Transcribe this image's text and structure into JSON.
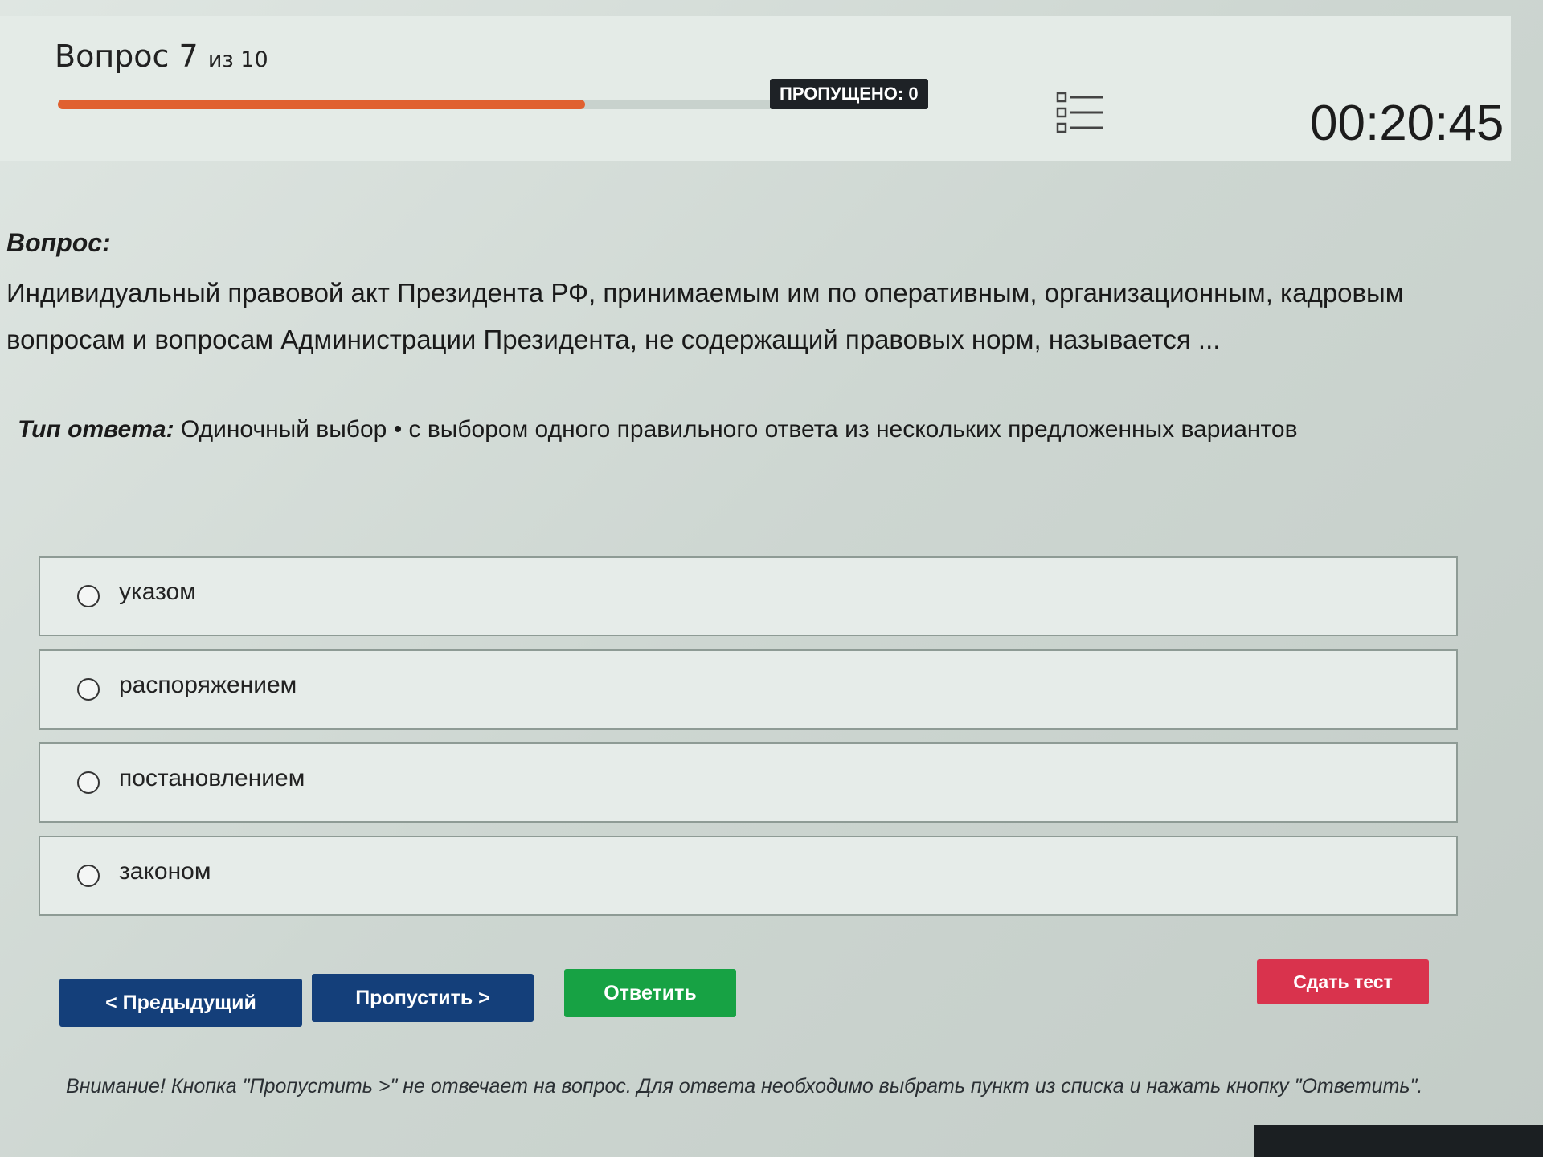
{
  "header": {
    "question_word": "Вопрос",
    "question_number": "7",
    "question_of": "из 10",
    "progress_percent": 61,
    "skipped_label": "ПРОПУЩЕНО: 0",
    "list_icon": "question-list-icon",
    "timer": "00:20:45",
    "progress_color": "#e0602f"
  },
  "question": {
    "label": "Вопрос:",
    "text": "Индивидуальный правовой акт Президента РФ, принимаемым им по оперативным, организационным, кадровым вопросам и вопросам Администрации Президента, не содержащий правовых норм, называется ..."
  },
  "answer_type": {
    "label": "Тип ответа:",
    "value": "Одиночный выбор • с выбором одного правильного ответа из нескольких предложенных вариантов"
  },
  "options": [
    {
      "label": "указом"
    },
    {
      "label": "распоряжением"
    },
    {
      "label": "постановлением"
    },
    {
      "label": "законом"
    }
  ],
  "buttons": {
    "prev": "< Предыдущий",
    "skip": "Пропустить >",
    "answer": "Ответить",
    "submit": "Сдать тест"
  },
  "colors": {
    "nav_button": "#143f7a",
    "answer_button": "#17a244",
    "submit_button": "#d9334d"
  },
  "notice": "Внимание! Кнопка \"Пропустить >\" не отвечает на вопрос. Для ответа необходимо выбрать пункт из списка и нажать кнопку \"Ответить\"."
}
